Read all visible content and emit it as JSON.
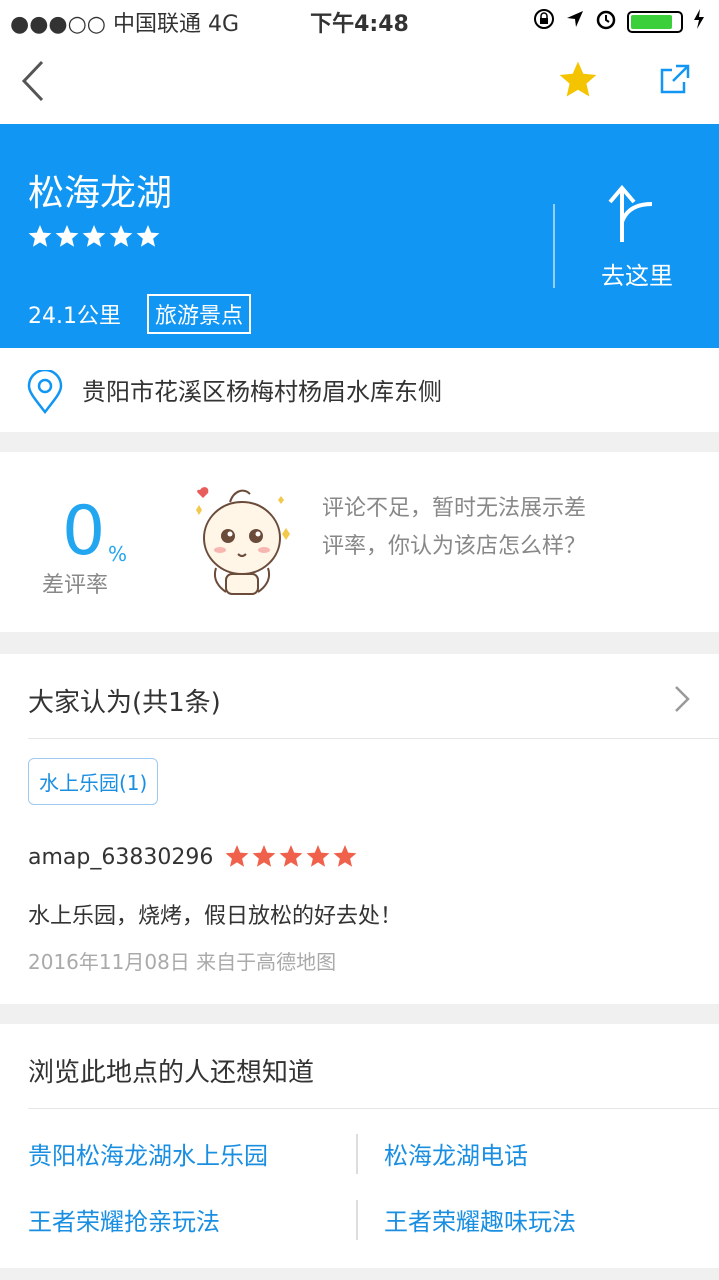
{
  "status_bar": {
    "carrier": "●●●○○ 中国联通   4G",
    "time": "下午4:48",
    "battery_percent": 85
  },
  "nav": {
    "back_icon": "chevron-left-icon",
    "favorite_icon": "star-icon",
    "share_icon": "share-icon"
  },
  "place": {
    "name": "松海龙湖",
    "rating_stars": 5,
    "distance": "24.1公里",
    "category": "旅游景点",
    "go_label": "去这里"
  },
  "address": {
    "text": "贵阳市花溪区杨梅村杨眉水库东侧"
  },
  "bad_rate": {
    "value": "0",
    "unit": "%",
    "label": "差评率",
    "message": "评论不足，暂时无法展示差评率，你认为该店怎么样？"
  },
  "reviews": {
    "header": "大家认为(共1条)",
    "keyword": "水上乐园(1)",
    "items": [
      {
        "user": "amap_63830296",
        "stars": 5,
        "content": "水上乐园，烧烤，假日放松的好去处！",
        "date_source": "2016年11月08日 来自于高德地图"
      }
    ]
  },
  "related": {
    "header": "浏览此地点的人还想知道",
    "links": [
      "贵阳松海龙湖水上乐园",
      "松海龙湖电话",
      "王者荣耀抢亲玩法",
      "王者荣耀趣味玩法"
    ]
  },
  "colors": {
    "brand": "#1196f4",
    "link": "#1a8fe2",
    "star_gold": "#f5c400",
    "star_red": "#f0614b"
  }
}
